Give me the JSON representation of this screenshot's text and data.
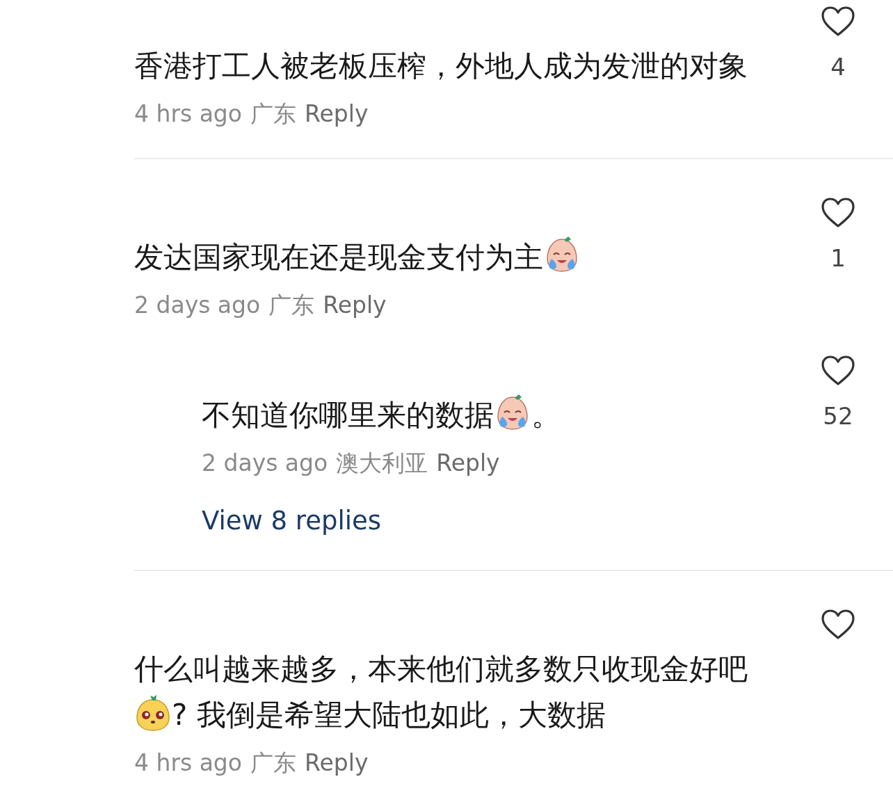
{
  "comments": [
    {
      "kind": "comment",
      "parts": [
        {
          "kind": "text",
          "text": "香港打工人被老板压榨，外地人成为发泄的对象"
        }
      ],
      "time": "4 hrs ago",
      "location": "广东",
      "reply_label": "Reply",
      "likes": "4"
    },
    {
      "kind": "comment",
      "parts": [
        {
          "kind": "text",
          "text": "发达国家现在还是现金支付为主"
        },
        {
          "kind": "crying"
        }
      ],
      "time": "2 days ago",
      "location": "广东",
      "reply_label": "Reply",
      "likes": "1"
    },
    {
      "kind": "reply",
      "parts": [
        {
          "kind": "text",
          "text": "不知道你哪里来的数据"
        },
        {
          "kind": "crying"
        },
        {
          "kind": "text",
          "text": "。"
        }
      ],
      "time": "2 days ago",
      "location": "澳大利亚",
      "reply_label": "Reply",
      "likes": "52",
      "more": "View 8 replies"
    },
    {
      "kind": "comment",
      "parts": [
        {
          "kind": "text",
          "text": "什么叫越来越多，本来他们就多数只收现金好吧"
        },
        {
          "kind": "puppy"
        },
        {
          "kind": "text",
          "text": "? 我倒是希望大陆也如此，大数据"
        }
      ],
      "time": "4 hrs ago",
      "location": "广东",
      "reply_label": "Reply"
    }
  ]
}
